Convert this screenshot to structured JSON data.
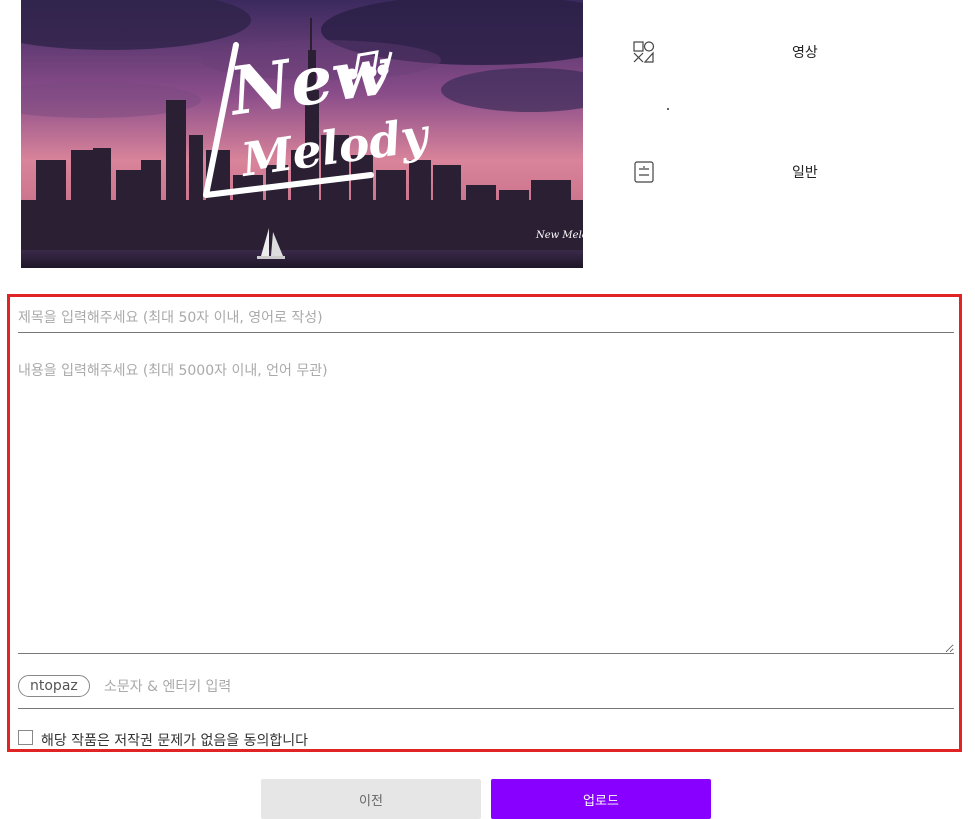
{
  "thumbnail": {
    "logo_line1": "New",
    "logo_line2": "Melody",
    "watermark": "New Melody"
  },
  "meta": {
    "type_icon": "shapes-icon",
    "type_label": "영상",
    "category_icon": "list-icon",
    "category_label": "일반"
  },
  "form": {
    "title_placeholder": "제목을 입력해주세요 (최대 50자 이내, 영어로 작성)",
    "content_placeholder": "내용을 입력해주세요 (최대 5000자 이내, 언어 무관)",
    "tags": [
      "ntopaz"
    ],
    "tag_placeholder": "소문자 & 엔터키 입력",
    "agree_label": "해당 작품은 저작권 문제가 없음을 동의합니다",
    "agree_checked": false
  },
  "buttons": {
    "prev_label": "이전",
    "upload_label": "업로드"
  },
  "colors": {
    "accent": "#8800ff",
    "highlight_border": "#e02424",
    "prev_button_bg": "#e6e6e6"
  }
}
